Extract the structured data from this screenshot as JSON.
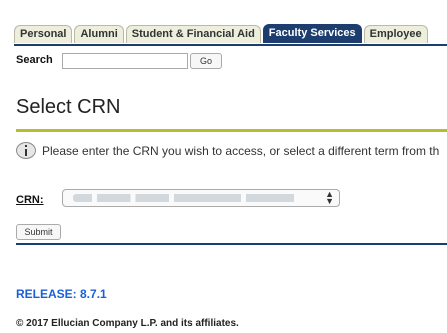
{
  "nav": {
    "tabs": [
      {
        "label": "Personal",
        "active": false
      },
      {
        "label": "Alumni",
        "active": false
      },
      {
        "label": "Student & Financial Aid",
        "active": false
      },
      {
        "label": "Faculty Services",
        "active": true
      },
      {
        "label": "Employee",
        "active": false
      }
    ]
  },
  "search": {
    "label": "Search",
    "value": "",
    "go_label": "Go"
  },
  "page": {
    "title": "Select CRN",
    "info_icon": "info-icon",
    "info_text": "Please enter the CRN you wish to access, or select a different term from th"
  },
  "form": {
    "crn_label": "CRN:",
    "crn_selected": "",
    "submit_label": "Submit"
  },
  "footer": {
    "release": "RELEASE: 8.7.1",
    "copyright": "© 2017 Ellucian Company L.P. and its affiliates."
  },
  "colors": {
    "nav_active": "#1c3d6e",
    "title_rule": "#b6be2a",
    "release_link": "#1a5fd6"
  }
}
